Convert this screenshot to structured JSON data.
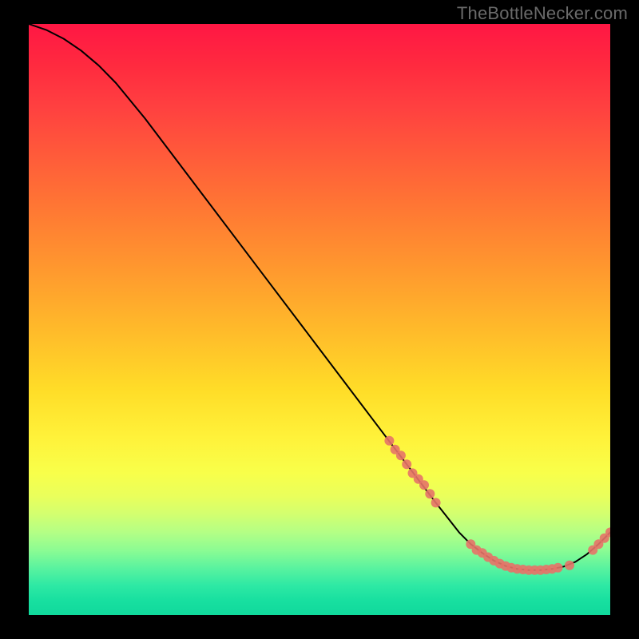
{
  "watermark": "TheBottleNecker.com",
  "colors": {
    "point": "#e57368",
    "line": "#000000"
  },
  "chart_data": {
    "type": "line",
    "title": "",
    "xlabel": "",
    "ylabel": "",
    "xlim": [
      0,
      100
    ],
    "ylim": [
      0,
      100
    ],
    "grid": false,
    "legend": false,
    "series": [
      {
        "name": "curve",
        "x": [
          0,
          3,
          6,
          9,
          12,
          15,
          20,
          30,
          40,
          50,
          60,
          65,
          70,
          72,
          74,
          76,
          78,
          80,
          82,
          84,
          86,
          88,
          90,
          92,
          94,
          96,
          98,
          100
        ],
        "y": [
          100,
          99,
          97.5,
          95.5,
          93,
          90,
          84,
          71,
          58,
          45,
          32,
          25.5,
          19,
          16.5,
          14,
          12,
          10.5,
          9.2,
          8.3,
          7.8,
          7.6,
          7.6,
          7.8,
          8.2,
          9,
          10.3,
          12,
          14
        ]
      }
    ],
    "scatter_points": {
      "name": "markers",
      "x": [
        62,
        63,
        64,
        65,
        66,
        67,
        68,
        69,
        70,
        76,
        77,
        78,
        79,
        80,
        81,
        82,
        83,
        84,
        85,
        86,
        87,
        88,
        89,
        90,
        91,
        93,
        97,
        98,
        99,
        100
      ],
      "y": [
        29.5,
        28,
        27,
        25.5,
        24,
        23,
        22,
        20.5,
        19,
        12,
        11,
        10.5,
        9.8,
        9.2,
        8.7,
        8.3,
        8,
        7.8,
        7.7,
        7.6,
        7.6,
        7.6,
        7.7,
        7.8,
        8,
        8.4,
        11,
        12,
        13,
        14
      ]
    }
  }
}
